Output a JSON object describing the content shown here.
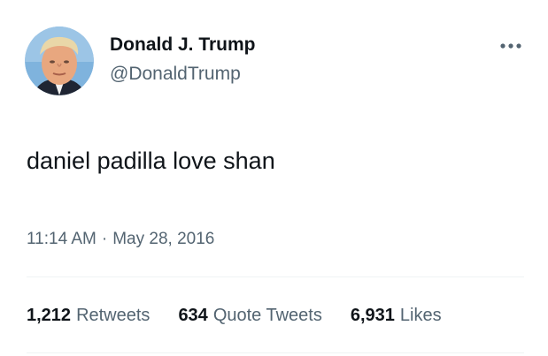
{
  "author": {
    "display_name": "Donald J. Trump",
    "handle": "@DonaldTrump",
    "avatar_icon": "profile-photo"
  },
  "more_icon": "more-options-icon",
  "tweet": {
    "text": "daniel padilla love shan",
    "time": "11:14 AM",
    "separator": "·",
    "date": "May 28, 2016"
  },
  "stats": {
    "retweets": {
      "value": "1,212",
      "label": "Retweets"
    },
    "quote_tweets": {
      "value": "634",
      "label": "Quote Tweets"
    },
    "likes": {
      "value": "6,931",
      "label": "Likes"
    }
  },
  "colors": {
    "primary_text": "#0f1419",
    "secondary_text": "#536471",
    "divider": "#eff3f4"
  }
}
